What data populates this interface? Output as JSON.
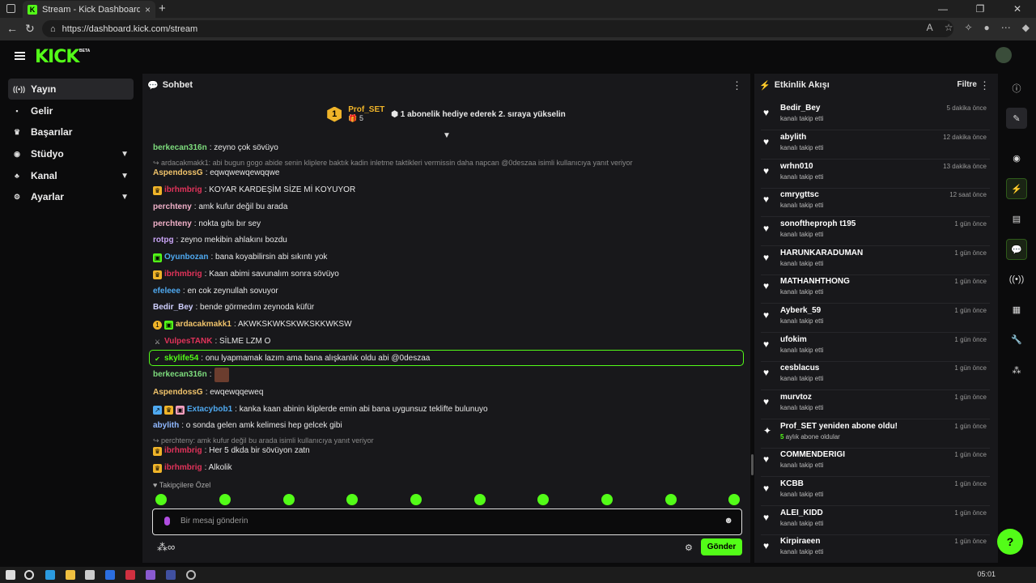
{
  "browser": {
    "tab_title": "Stream - Kick Dashboard",
    "url": "https://dashboard.kick.com/stream",
    "new_tab": "+",
    "close": "×"
  },
  "header": {
    "logo": "KICK",
    "beta": "BETA"
  },
  "sidebar": {
    "items": [
      {
        "label": "Yayın",
        "icon": "((•))"
      },
      {
        "label": "Gelir",
        "icon": "▪"
      },
      {
        "label": "Başarılar",
        "icon": "♛"
      },
      {
        "label": "Stüdyo",
        "icon": "◉"
      },
      {
        "label": "Kanal",
        "icon": "♣"
      },
      {
        "label": "Ayarlar",
        "icon": "⚙"
      }
    ]
  },
  "chat": {
    "title": "Sohbet",
    "pinned": {
      "rank": "1",
      "user": "Prof_SET",
      "count": "5",
      "message": "1 abonelik hediye ederek 2. sıraya yükselin"
    },
    "messages": [
      {
        "user": "berkecan316n",
        "color": "#7ddc7d",
        "text": ": zeyno çok sövüyo"
      },
      {
        "reply": "ardacakmakk1: abi bugun gogo abide senin kliplere baktık kadin inletme taktikleri vermissin daha napcan @0deszaa isimli kullanıcıya yanıt veriyor"
      },
      {
        "user": "AspendossG",
        "color": "#f0c36b",
        "text": ": eqwqwewqewqqwe"
      },
      {
        "user": "ibrhmbrig",
        "color": "#e0335a",
        "text": ": KOYAR KARDEŞİM SİZE Mİ KOYUYOR"
      },
      {
        "user": "perchteny",
        "color": "#f0b0c8",
        "text": ": amk kufur değil bu arada"
      },
      {
        "user": "perchteny",
        "color": "#f0b0c8",
        "text": ": nokta gıbı bır sey"
      },
      {
        "user": "rotpg",
        "color": "#c9a4f5",
        "text": ": zeyno mekibin ahlakını bozdu"
      },
      {
        "user": "Oyunbozan",
        "color": "#4fa9f0",
        "text": ": bana koyabilirsin abi sıkıntı yok"
      },
      {
        "user": "ibrhmbrig",
        "color": "#e0335a",
        "text": ": Kaan abimi savunalım sonra sövüyo"
      },
      {
        "user": "efeleee",
        "color": "#4fa9f0",
        "text": ": en cok zeynullah sovuyor"
      },
      {
        "user": "Bedir_Bey",
        "color": "#d0d0ff",
        "text": ": bende görmedım zeynoda küfür"
      },
      {
        "user": "ardacakmakk1",
        "color": "#f0c36b",
        "text": ": AKWKSKWKSKWKSKKWKSW"
      },
      {
        "user": "VulpesTANK",
        "color": "#e0335a",
        "text": ": SİLME LZM O"
      },
      {
        "user": "skylife54",
        "color": "#53fc18",
        "text": ": onu lyapmamak lazım ama bana alışkanlık oldu abi @0deszaa"
      },
      {
        "user": "berkecan316n",
        "color": "#7ddc7d",
        "text": ":"
      },
      {
        "user": "AspendossG",
        "color": "#f0c36b",
        "text": ": ewqewqqeweq"
      },
      {
        "user": "Extacybob1",
        "color": "#4fa9f0",
        "text": ": kanka kaan abinin kliplerde emin abi bana uygunsuz teklifte bulunuyo"
      },
      {
        "user": "abylith",
        "color": "#8fb8ff",
        "text": ": o sonda gelen amk kelimesi hep gelcek gibi"
      },
      {
        "reply": "perchteny: amk kufur değil bu arada isimli kullanıcıya yanıt veriyor"
      },
      {
        "user": "ibrhmbrig",
        "color": "#e0335a",
        "text": ": Her 5 dkda bir sövüyon zatn"
      },
      {
        "user": "ibrhmbrig",
        "color": "#e0335a",
        "text": ": Alkolik"
      }
    ],
    "follow_note": "Takipçilere Özel",
    "input_placeholder": "Bir mesaj gönderin",
    "send_label": "Gönder"
  },
  "feed": {
    "title": "Etkinlik Akışı",
    "filter": "Filtre",
    "items": [
      {
        "name": "Bedir_Bey",
        "sub": "kanalı takip etti",
        "time": "5 dakika önce"
      },
      {
        "name": "abylith",
        "sub": "kanalı takip etti",
        "time": "12 dakika önce"
      },
      {
        "name": "wrhn010",
        "sub": "kanalı takip etti",
        "time": "13 dakika önce"
      },
      {
        "name": "cmrygttsc",
        "sub": "kanalı takip etti",
        "time": "12 saat önce"
      },
      {
        "name": "sonoftheproph t195",
        "sub": "kanalı takip etti",
        "time": "1 gün önce"
      },
      {
        "name": "HARUNKARADUMAN",
        "sub": "kanalı takip etti",
        "time": "1 gün önce"
      },
      {
        "name": "MATHANHTHONG",
        "sub": "kanalı takip etti",
        "time": "1 gün önce"
      },
      {
        "name": "Ayberk_59",
        "sub": "kanalı takip etti",
        "time": "1 gün önce"
      },
      {
        "name": "ufokim",
        "sub": "kanalı takip etti",
        "time": "1 gün önce"
      },
      {
        "name": "cesblacus",
        "sub": "kanalı takip etti",
        "time": "1 gün önce"
      },
      {
        "name": "murvtoz",
        "sub": "kanalı takip etti",
        "time": "1 gün önce"
      },
      {
        "name": "Prof_SET yeniden abone oldu!",
        "sub_num": "5",
        "sub": " aylık abone oldular",
        "time": "1 gün önce",
        "sub_event": true
      },
      {
        "name": "COMMENDERIGI",
        "sub": "kanalı takip etti",
        "time": "1 gün önce"
      },
      {
        "name": "KCBB",
        "sub": "kanalı takip etti",
        "time": "1 gün önce"
      },
      {
        "name": "ALEI_KIDD",
        "sub": "kanalı takip etti",
        "time": "1 gün önce"
      },
      {
        "name": "Kirpiraeen",
        "sub": "kanalı takip etti",
        "time": "1 gün önce"
      }
    ]
  },
  "taskbar": {
    "time": "05:01"
  },
  "colors": {
    "accent": "#53fc18",
    "panel": "#18181b",
    "background": "#0b0b0c"
  }
}
